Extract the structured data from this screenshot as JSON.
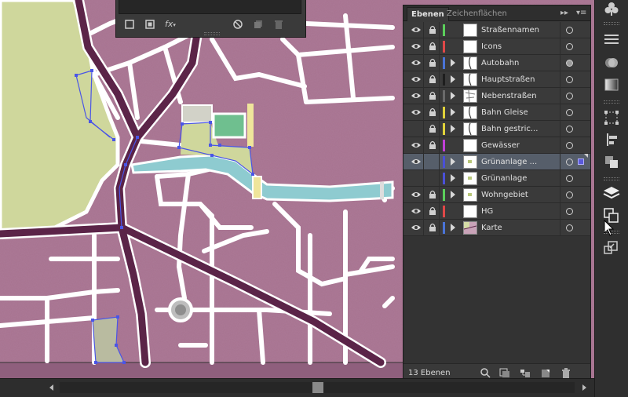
{
  "layers_panel": {
    "tabs": [
      {
        "label": "Ebenen",
        "active": true
      },
      {
        "label": "Zeichenflächen",
        "active": false
      }
    ],
    "collapse_glyph": "▸▸",
    "menu_glyph": "▾≡",
    "layers": [
      {
        "name": "Straßennamen",
        "color": "#5bcf5b",
        "visible": true,
        "locked": true,
        "expandable": false,
        "thumb": "blank",
        "target_filled": false
      },
      {
        "name": "Icons",
        "color": "#e04848",
        "visible": true,
        "locked": true,
        "expandable": false,
        "thumb": "blank",
        "target_filled": false
      },
      {
        "name": "Autobahn",
        "color": "#4a74d8",
        "visible": true,
        "locked": true,
        "expandable": true,
        "thumb": "road",
        "target_filled": true
      },
      {
        "name": "Hauptstraßen",
        "color": "#1e1e1e",
        "visible": true,
        "locked": true,
        "expandable": true,
        "thumb": "road",
        "target_filled": false
      },
      {
        "name": "Nebenstraßen",
        "color": "#6a6a6a",
        "visible": true,
        "locked": true,
        "expandable": true,
        "thumb": "streets",
        "target_filled": false
      },
      {
        "name": "Bahn Gleise",
        "color": "#e0d23a",
        "visible": true,
        "locked": true,
        "expandable": true,
        "thumb": "road",
        "target_filled": false
      },
      {
        "name": "Bahn gestric...",
        "color": "#e0d23a",
        "visible": false,
        "locked": true,
        "expandable": true,
        "thumb": "road",
        "target_filled": false
      },
      {
        "name": "Gewässer",
        "color": "#c040d8",
        "visible": true,
        "locked": true,
        "expandable": false,
        "thumb": "blank",
        "target_filled": false
      },
      {
        "name": "Grünanlage ...",
        "color": "#4a50d8",
        "visible": true,
        "locked": false,
        "expandable": true,
        "thumb": "green",
        "target_filled": false,
        "selected": true
      },
      {
        "name": "Grünanlage",
        "color": "#4a50d8",
        "visible": false,
        "locked": false,
        "expandable": true,
        "thumb": "green",
        "target_filled": false
      },
      {
        "name": "Wohngebiet",
        "color": "#5bcf5b",
        "visible": true,
        "locked": true,
        "expandable": true,
        "thumb": "green",
        "target_filled": false
      },
      {
        "name": "HG",
        "color": "#e04848",
        "visible": true,
        "locked": true,
        "expandable": false,
        "thumb": "blank",
        "target_filled": false
      },
      {
        "name": "Karte",
        "color": "#4a74d8",
        "visible": true,
        "locked": true,
        "expandable": true,
        "thumb": "map",
        "target_filled": false
      }
    ],
    "footer": {
      "count_label": "13 Ebenen"
    }
  },
  "appearance_panel": {
    "fx_label": "fx"
  },
  "dock": {
    "icons": [
      "club-icon",
      "stroke-icon",
      "transparency-icon",
      "gradient-icon",
      "transform-icon",
      "align-icon",
      "pathfinder-icon",
      "layers-icon",
      "artboards-icon",
      "export-icon"
    ]
  },
  "colors": {
    "map_fill": "#a7728f",
    "road": "#5b2448",
    "water": "#8ecbd0",
    "park": "#cfd79c",
    "selection": "#4a55e6"
  }
}
